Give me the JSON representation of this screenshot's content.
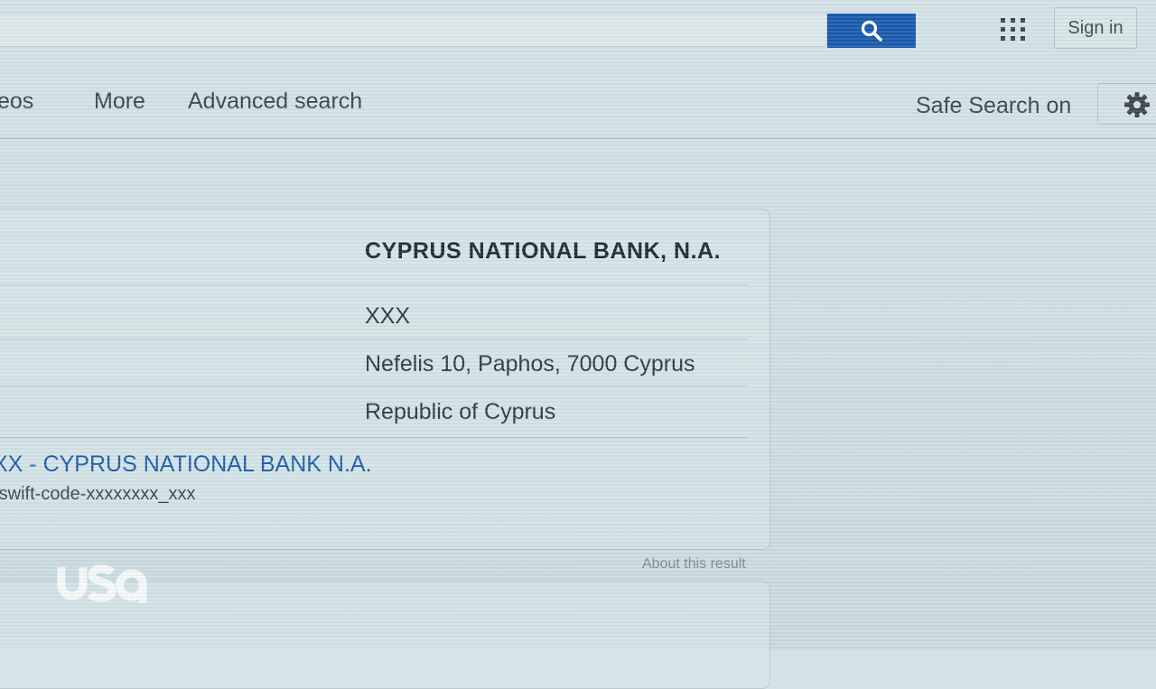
{
  "header": {
    "search_value": "",
    "search_icon": "search-icon",
    "apps_icon": "apps-grid-icon",
    "signin_label": "Sign in"
  },
  "nav": {
    "items": [
      {
        "label": "eos"
      },
      {
        "label": "More"
      },
      {
        "label": "Advanced search"
      }
    ],
    "safe_search": "Safe Search on",
    "settings_icon": "gear-icon"
  },
  "result_card": {
    "bank_name": "CYPRUS NATIONAL BANK, N.A.",
    "code": "XXX",
    "address": "Nefelis 10, Paphos, 7000 Cyprus",
    "country": "Republic of Cyprus",
    "link_title": "XX - CYPRUS NATIONAL BANK N.A.",
    "link_url": "-swift-code-xxxxxxxx_xxx",
    "about": "About this result"
  },
  "watermark": {
    "logo_text": "usa"
  },
  "colors": {
    "search_button": "#1859ad",
    "link": "#1e5ca8",
    "background": "#cfdfe3"
  }
}
